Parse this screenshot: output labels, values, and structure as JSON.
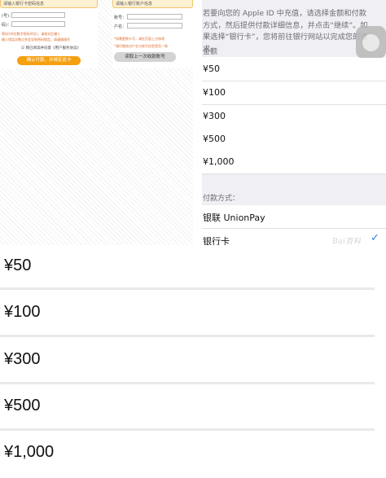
{
  "form_left": {
    "header_text": "请输入银行卡密码信息",
    "field1_label": "(号)：",
    "field2_label": "码)：",
    "note1": "密码为6位数字密码(6位)，请核对后输入",
    "note2": "输入错误次数过多会导致密码锁定，请谨慎操作",
    "agree_text": "我已阅读并同意《用户服务协议》",
    "submit_label": "确认付款，并绑定此卡"
  },
  "form_right": {
    "header_text": "请输入银行账户信息",
    "account_label": "账号：",
    "name_label": "户名：",
    "note1": "*如需更换卡号，请在页面上方修改",
    "note2": "*请仔细核对户名与账号信息是否一致",
    "reuse_label": "读取上一次收款账号"
  },
  "recharge": {
    "intro_text": "若要向您的 Apple ID 中充值，请选择金额和付款方式，然后提供付款详细信息，并点击“继续”。如果选择“银行卡”，您将前往银行网站以完成您的请求。",
    "amount_label": "金额",
    "amounts": [
      "¥50",
      "¥100",
      "¥300",
      "¥500",
      "¥1,000"
    ],
    "payment_label": "付款方式：",
    "payment_options": [
      "银联 UnionPay",
      "银行卡"
    ],
    "selected_payment": "银行卡",
    "watermark": "Bai百科",
    "check_color": "#2f7cf6"
  },
  "big_list": {
    "amounts": [
      "¥50",
      "¥100",
      "¥300",
      "¥500",
      "¥1,000"
    ]
  }
}
